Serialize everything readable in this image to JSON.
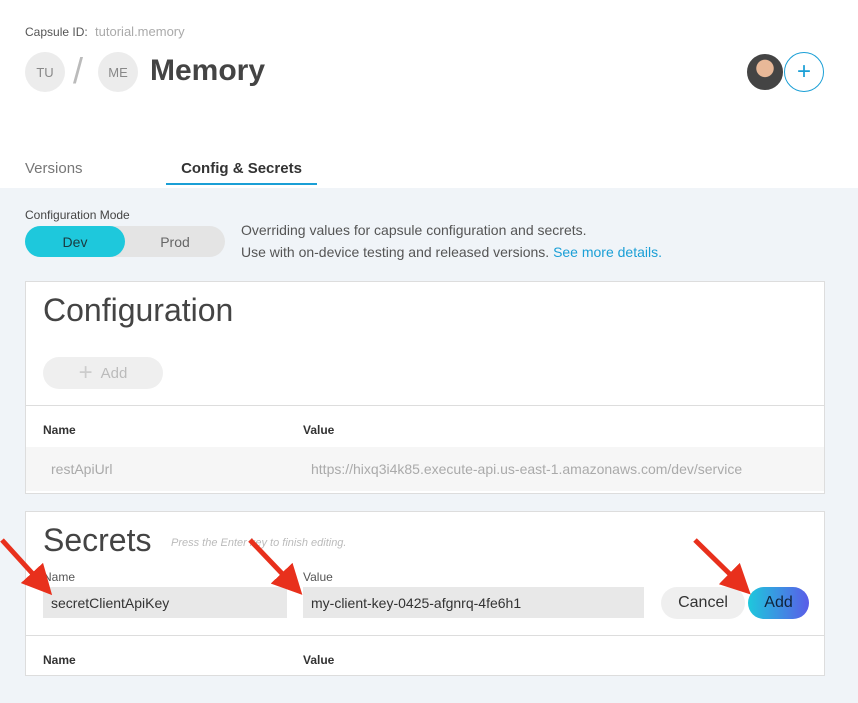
{
  "header": {
    "capsule_id_label": "Capsule ID:",
    "capsule_id_value": "tutorial.memory",
    "org_initials": "TU",
    "capsule_initials": "ME",
    "separator": "/",
    "title": "Memory",
    "add_member_symbol": "+"
  },
  "tabs": [
    {
      "label": "Versions",
      "active": false
    },
    {
      "label": "Config & Secrets",
      "active": true
    }
  ],
  "mode": {
    "label": "Configuration Mode",
    "options": [
      "Dev",
      "Prod"
    ],
    "selected": "Dev",
    "description_line1": "Overriding values for capsule configuration and secrets.",
    "description_line2": "Use with on-device testing and released versions.",
    "details_link": "See more details."
  },
  "configuration": {
    "title": "Configuration",
    "add_label": "Add",
    "add_symbol": "+",
    "columns": [
      "Name",
      "Value"
    ],
    "rows": [
      {
        "name": "restApiUrl",
        "value": "https://hixq3i4k85.execute-api.us-east-1.amazonaws.com/dev/service"
      }
    ]
  },
  "secrets": {
    "title": "Secrets",
    "hint": "Press the Enter key to finish editing.",
    "name_label": "Name",
    "value_label": "Value",
    "name_input": "secretClientApiKey",
    "value_input": "my-client-key-0425-afgnrq-4fe6h1",
    "cancel_label": "Cancel",
    "add_label": "Add",
    "columns": [
      "Name",
      "Value"
    ]
  },
  "colors": {
    "accent": "#1a9fd6",
    "toggle_active": "#1ec8dc",
    "annotation_arrow": "#e8301c"
  }
}
